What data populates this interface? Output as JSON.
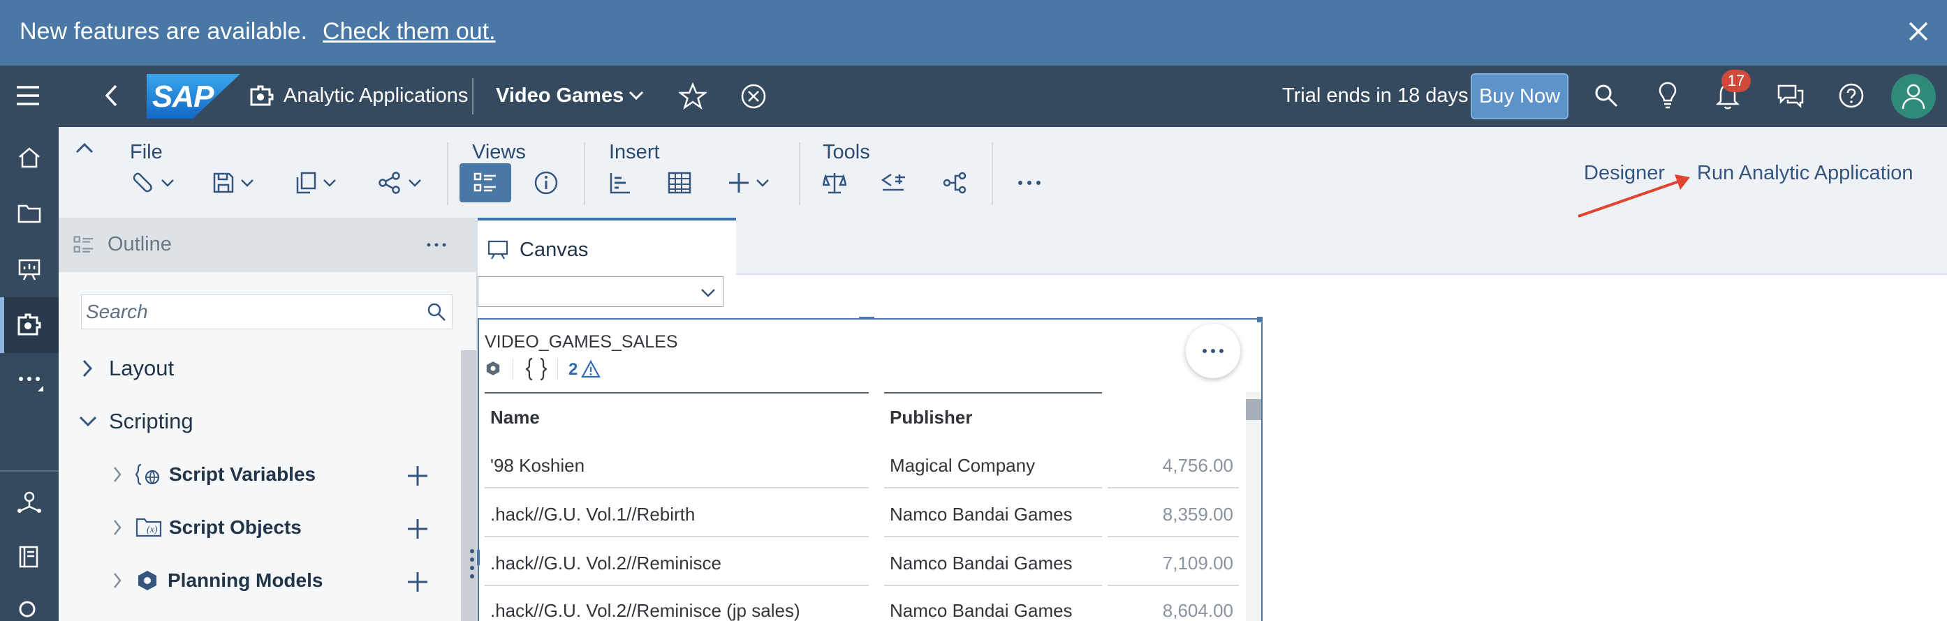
{
  "banner": {
    "message": "New features are available.",
    "link": "Check them out."
  },
  "shell": {
    "logo": "SAP",
    "app_name": "Analytic Applications",
    "doc_title": "Video Games",
    "trial": "Trial ends in 18 days",
    "buy_now": "Buy Now",
    "notification_count": "17"
  },
  "toolbar": {
    "groups": {
      "file": "File",
      "views": "Views",
      "insert": "Insert",
      "tools": "Tools"
    },
    "designer": "Designer",
    "run": "Run Analytic Application"
  },
  "outline": {
    "title": "Outline",
    "search_placeholder": "Search",
    "items": {
      "layout": "Layout",
      "scripting": "Scripting",
      "script_variables": "Script Variables",
      "script_objects": "Script Objects",
      "planning_models": "Planning Models"
    }
  },
  "canvas": {
    "tab": "Canvas",
    "widget": {
      "title": "VIDEO_GAMES_SALES",
      "warnings": "2",
      "columns": [
        "Name",
        "Publisher"
      ],
      "rows": [
        {
          "name": "'98 Koshien",
          "publisher": "Magical Company",
          "value": "4,756.00"
        },
        {
          "name": ".hack//G.U. Vol.1//Rebirth",
          "publisher": "Namco Bandai Games",
          "value": "8,359.00"
        },
        {
          "name": ".hack//G.U. Vol.2//Reminisce",
          "publisher": "Namco Bandai Games",
          "value": "7,109.00"
        },
        {
          "name": ".hack//G.U. Vol.2//Reminisce (jp sales)",
          "publisher": "Namco Bandai Games",
          "value": "8,604.00"
        }
      ]
    }
  },
  "colors": {
    "banner": "#4a78a6",
    "shell": "#354a5f",
    "accent": "#3b73b0",
    "annotation_arrow": "#e0452f"
  }
}
